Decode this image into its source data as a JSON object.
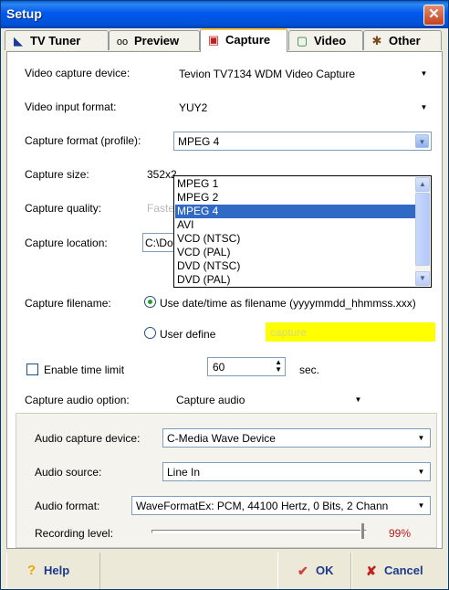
{
  "window": {
    "title": "Setup"
  },
  "tabs": [
    {
      "label": "TV Tuner",
      "icon": "tv-tuner-icon"
    },
    {
      "label": "Preview",
      "icon": "glasses-icon"
    },
    {
      "label": "Capture",
      "icon": "capture-icon"
    },
    {
      "label": "Video",
      "icon": "video-icon"
    },
    {
      "label": "Other",
      "icon": "other-icon"
    }
  ],
  "active_tab": "Capture",
  "fields": {
    "video_capture_device": {
      "label": "Video capture device:",
      "value": "Tevion TV7134 WDM Video Capture"
    },
    "video_input_format": {
      "label": "Video input format:",
      "value": "YUY2"
    },
    "capture_format": {
      "label": "Capture format (profile):",
      "value": "MPEG 4"
    },
    "capture_size": {
      "label": "Capture size:",
      "value": "352x2"
    },
    "capture_quality": {
      "label": "Capture quality:",
      "value": "Faste"
    },
    "capture_location": {
      "label": "Capture location:",
      "value": "C:\\Do"
    },
    "capture_filename": {
      "label": "Capture filename:",
      "option_date": "Use date/time as filename (yyyymmdd_hhmmss.xxx)",
      "option_user": "User define",
      "user_value": "capture",
      "selected": "date"
    },
    "time_limit": {
      "label": "Enable time limit",
      "checked": false,
      "value": "60",
      "unit": "sec."
    },
    "capture_audio_option": {
      "label": "Capture audio option:",
      "value": "Capture audio"
    }
  },
  "dropdown": {
    "options": [
      "MPEG 1",
      "MPEG 2",
      "MPEG 4",
      "AVI",
      "VCD (NTSC)",
      "VCD (PAL)",
      "DVD (NTSC)",
      "DVD (PAL)"
    ],
    "selected": "MPEG 4"
  },
  "audio": {
    "device": {
      "label": "Audio capture device:",
      "value": "C-Media Wave Device"
    },
    "source": {
      "label": "Audio source:",
      "value": "Line In"
    },
    "format": {
      "label": "Audio format:",
      "value": "WaveFormatEx: PCM, 44100 Hertz, 0 Bits, 2 Chann"
    },
    "level": {
      "label": "Recording level:",
      "value": "99%",
      "fraction": 0.99
    }
  },
  "buttons": {
    "help": "Help",
    "ok": "OK",
    "cancel": "Cancel"
  },
  "colors": {
    "title_bar": "#0058ee",
    "highlight": "#316ac5",
    "user_define_bg": "#ffff00",
    "level_text": "#b81c1c"
  }
}
